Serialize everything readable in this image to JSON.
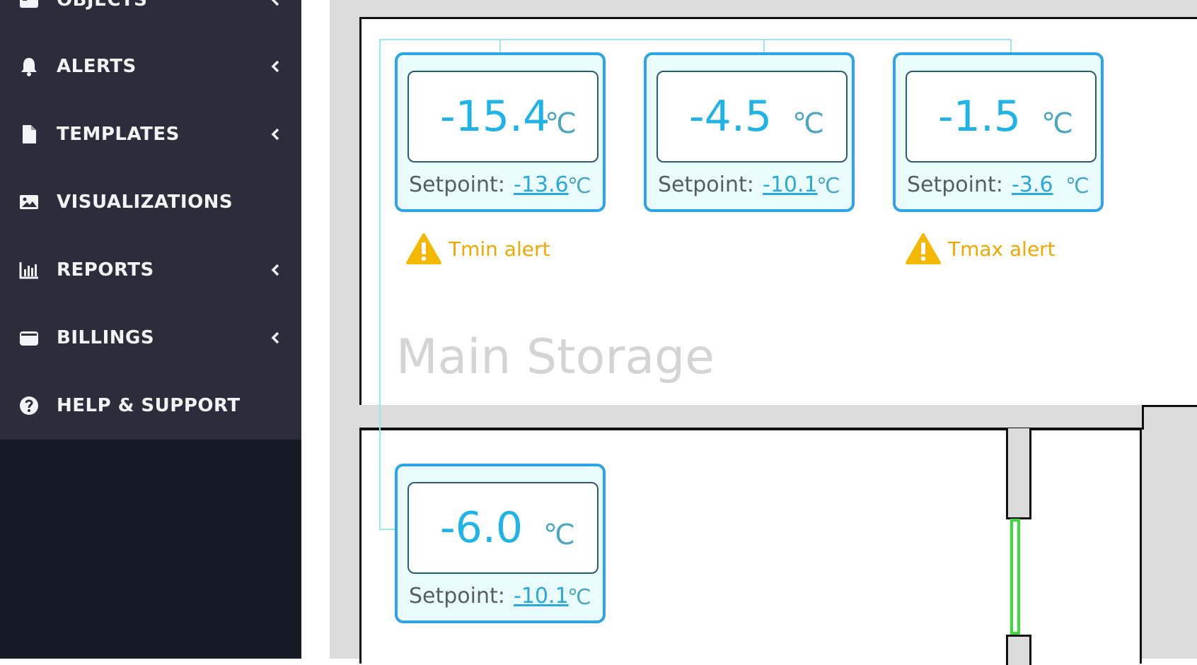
{
  "sidebar": {
    "items": [
      {
        "label": "OBJECTS",
        "icon": "objects-icon",
        "has_submenu": true
      },
      {
        "label": "ALERTS",
        "icon": "bell-icon",
        "has_submenu": true
      },
      {
        "label": "TEMPLATES",
        "icon": "file-icon",
        "has_submenu": true
      },
      {
        "label": "VISUALIZATIONS",
        "icon": "image-icon",
        "has_submenu": false
      },
      {
        "label": "REPORTS",
        "icon": "bar-chart-icon",
        "has_submenu": true
      },
      {
        "label": "BILLINGS",
        "icon": "wallet-icon",
        "has_submenu": true
      },
      {
        "label": "HELP & SUPPORT",
        "icon": "help-circle-icon",
        "has_submenu": false
      }
    ]
  },
  "floorplan": {
    "room_title": "Main Storage",
    "sensors": [
      {
        "temperature": "-15.4",
        "unit": "℃",
        "setpoint_label": "Setpoint:",
        "setpoint_value": "-13.6",
        "setpoint_unit": "℃"
      },
      {
        "temperature": "-4.5",
        "unit": "℃",
        "setpoint_label": "Setpoint:",
        "setpoint_value": "-10.1",
        "setpoint_unit": "℃"
      },
      {
        "temperature": "-1.5",
        "unit": "℃",
        "setpoint_label": "Setpoint:",
        "setpoint_value": "-3.6",
        "setpoint_unit": "℃"
      },
      {
        "temperature": "-6.0",
        "unit": "℃",
        "setpoint_label": "Setpoint:",
        "setpoint_value": "-10.1",
        "setpoint_unit": "℃"
      }
    ],
    "alerts": [
      {
        "label": "Tmin alert",
        "icon": "warning-icon"
      },
      {
        "label": "Tmax alert",
        "icon": "warning-icon"
      }
    ]
  },
  "colors": {
    "sidebar_bg": "#2b2e3a",
    "sidebar_bottom_bg": "#161a24",
    "card_border": "#2ea3e6",
    "temperature_text": "#1fb3e6",
    "alert": "#f0a800",
    "door_green": "#3ddc3d"
  }
}
